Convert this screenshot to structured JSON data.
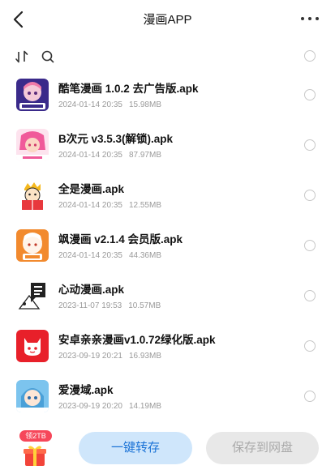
{
  "header": {
    "title": "漫画APP",
    "back_icon": "chevron-left-icon",
    "more_icon": "more-horizontal-icon"
  },
  "toolbar": {
    "sort_icon": "sort-icon",
    "search_icon": "search-icon"
  },
  "files": [
    {
      "name": "酷笔漫画 1.0.2 去广告版.apk",
      "date": "2024-01-14 20:35",
      "size": "15.98MB",
      "icon": "app-icon-kubi"
    },
    {
      "name": "B次元 v3.5.3(解锁).apk",
      "date": "2024-01-14 20:35",
      "size": "87.97MB",
      "icon": "app-icon-bciyuan"
    },
    {
      "name": "全是漫画.apk",
      "date": "2024-01-14 20:35",
      "size": "12.55MB",
      "icon": "app-icon-quanshi"
    },
    {
      "name": "飒漫画 v2.1.4 会员版.apk",
      "date": "2024-01-14 20:35",
      "size": "44.36MB",
      "icon": "app-icon-sa"
    },
    {
      "name": "心动漫画.apk",
      "date": "2023-11-07 19:53",
      "size": "10.57MB",
      "icon": "app-icon-xindong"
    },
    {
      "name": "安卓亲亲漫画v1.0.72绿化版.apk",
      "date": "2023-09-19 20:21",
      "size": "16.93MB",
      "icon": "app-icon-qinqin"
    },
    {
      "name": "爱漫域.apk",
      "date": "2023-09-19 20:20",
      "size": "14.19MB",
      "icon": "app-icon-aimanyu"
    }
  ],
  "bottom": {
    "gift_badge": "领2TB",
    "transfer_label": "一键转存",
    "save_label": "保存到网盘"
  },
  "colors": {
    "primary_btn_bg": "#cfe6fb",
    "primary_btn_text": "#1a72d6",
    "disabled_btn_bg": "#e8e8e8",
    "badge": "#f6475a"
  }
}
